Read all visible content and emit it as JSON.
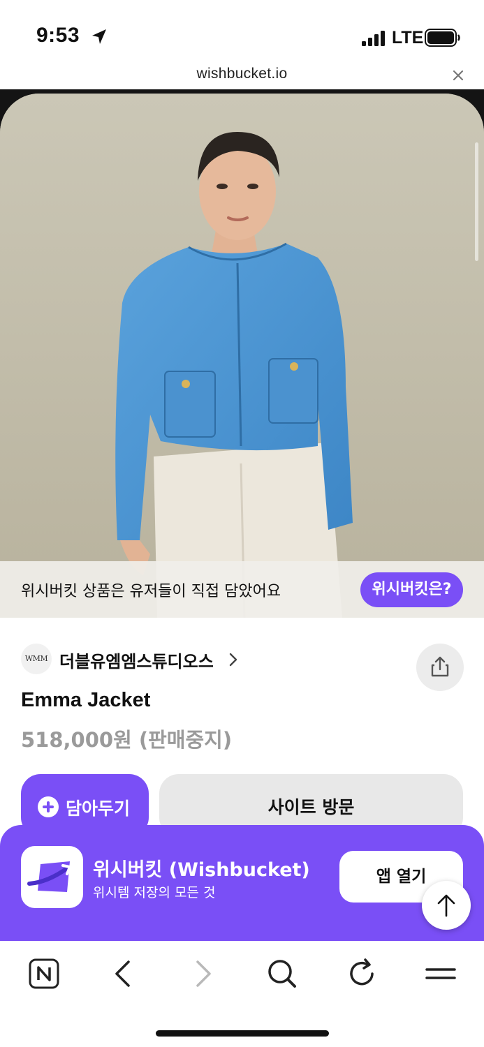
{
  "status_bar": {
    "time": "9:53",
    "network": "LTE",
    "icons": [
      "location-arrow-icon",
      "signal-icon",
      "battery-icon"
    ]
  },
  "url_bar": {
    "domain": "wishbucket.io",
    "close_icon": "close-icon"
  },
  "hero": {
    "notice_text": "위시버킷 상품은 유저들이 직접 담았어요",
    "notice_button": "위시버킷은?"
  },
  "product": {
    "brand_logo_text": "WMM",
    "brand_name": "더블유엠엠스튜디오스",
    "title": "Emma Jacket",
    "price": "518,000원 (판매중지)"
  },
  "actions": {
    "save_label": "담아두기",
    "visit_label": "사이트 방문"
  },
  "app_banner": {
    "name": "위시버킷 (Wishbucket)",
    "subtitle": "위시템 저장의 모든 것",
    "open_label": "앱 열기"
  },
  "toolbar": {
    "items": [
      "naver-home-icon",
      "back-icon",
      "forward-icon",
      "search-icon",
      "reload-icon",
      "menu-icon"
    ]
  },
  "colors": {
    "accent": "#7a4ff6",
    "price_gray": "#9a9a9a",
    "button_gray": "#e8e8e8",
    "jacket_blue": "#4a93d1"
  }
}
